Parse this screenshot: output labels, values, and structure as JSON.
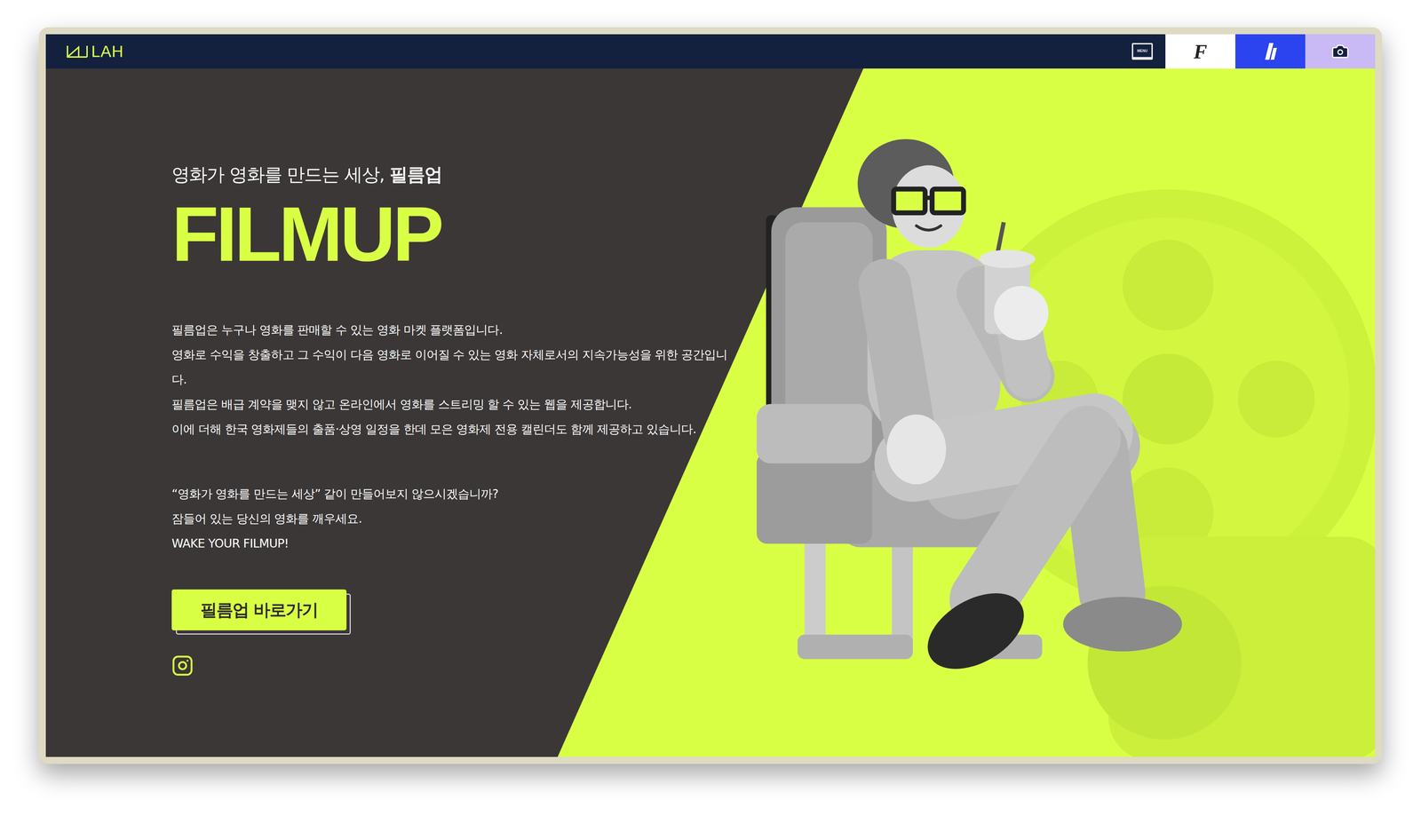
{
  "nav": {
    "logo": "LAH",
    "menu_label": "MENU",
    "tabs": [
      {
        "kind": "letter",
        "label": "F",
        "color": "#ffffff"
      },
      {
        "kind": "clapper",
        "color": "#2b44f0"
      },
      {
        "kind": "camera",
        "color": "#c9b9f5"
      }
    ]
  },
  "hero": {
    "tagline": "영화가 영화를 만드는 세상, ",
    "tagline_bold": "필름업",
    "title": "FILMUP",
    "description": [
      "필름업은 누구나 영화를 판매할 수 있는 영화 마켓 플랫폼입니다.",
      "영화로 수익을 창출하고 그 수익이 다음 영화로 이어질 수 있는 영화 자체로서의 지속가능성을 위한 공간입니다.",
      "필름업은 배급 계약을 맺지 않고 온라인에서 영화를 스트리밍 할 수 있는 웹을 제공합니다.",
      "이에 더해 한국 영화제들의 출품·상영 일정을 한데 모은 영화제 전용 캘린더도 함께 제공하고 있습니다."
    ],
    "quote": [
      "“영화가 영화를 만드는 세상” 같이 만들어보지 않으시겠습니까?",
      "잠들어 있는 당신의 영화를 깨우세요.",
      "WAKE YOUR FILMUP!"
    ],
    "cta": "필름업 바로가기"
  }
}
